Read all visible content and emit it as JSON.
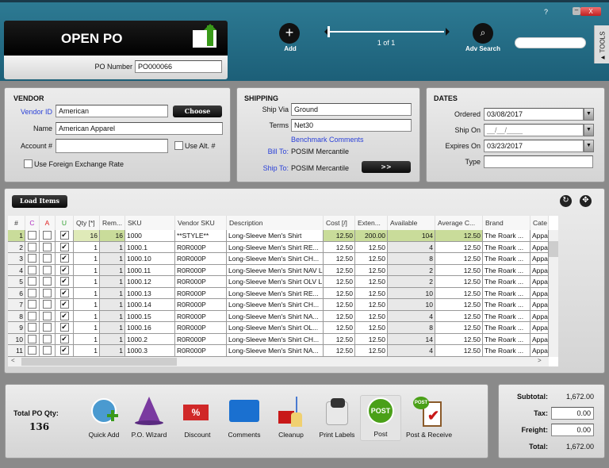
{
  "window": {
    "help": "?",
    "minimize": "–",
    "close": "X"
  },
  "header": {
    "title": "OPEN PO",
    "po_number_label": "PO Number",
    "po_number": "PO000066",
    "add_label": "Add",
    "pager": "1 of 1",
    "adv_search_label": "Adv Search",
    "search_placeholder": "",
    "tools_label": "TOOLS"
  },
  "vendor": {
    "heading": "VENDOR",
    "vendor_id_label": "Vendor ID",
    "vendor_id": "American",
    "choose": "Choose",
    "name_label": "Name",
    "name": "American Apparel",
    "account_label": "Account #",
    "account": "",
    "use_alt_label": "Use Alt. #",
    "use_alt": false,
    "foreign_label": "Use Foreign Exchange Rate",
    "foreign": false
  },
  "shipping": {
    "heading": "SHIPPING",
    "ship_via_label": "Ship Via",
    "ship_via": "Ground",
    "terms_label": "Terms",
    "terms": "Net30",
    "benchmark": "Benchmark Comments",
    "bill_to_label": "Bill To:",
    "bill_to": "POSIM Mercantile",
    "ship_to_label": "Ship To:",
    "ship_to": "POSIM Mercantile",
    "more": ">>"
  },
  "dates": {
    "heading": "DATES",
    "ordered_label": "Ordered",
    "ordered": "03/08/2017",
    "ship_on_label": "Ship On",
    "ship_on": "__/__/____",
    "expires_label": "Expires On",
    "expires": "03/23/2017",
    "type_label": "Type",
    "type": ""
  },
  "items": {
    "load_items": "Load Items",
    "columns": [
      "#",
      "C",
      "A",
      "U",
      "Qty [*]",
      "Rem...",
      "SKU",
      "Vendor SKU",
      "Description",
      "Cost [/]",
      "Exten...",
      "Available",
      "Average C...",
      "Brand",
      "Cate"
    ],
    "rows": [
      [
        "1",
        false,
        false,
        true,
        "16",
        "16",
        "1000",
        "**STYLE**",
        "Long-Sleeve Men's Shirt",
        "12.50",
        "200.00",
        "104",
        "12.50",
        "The Roark ...",
        "Appa"
      ],
      [
        "2",
        false,
        false,
        true,
        "1",
        "1",
        "1000.1",
        "R0R000P",
        "Long-Sleeve Men's Shirt RE...",
        "12.50",
        "12.50",
        "4",
        "12.50",
        "The Roark ...",
        "Appa"
      ],
      [
        "3",
        false,
        false,
        true,
        "1",
        "1",
        "1000.10",
        "R0R000P",
        "Long-Sleeve Men's Shirt CH...",
        "12.50",
        "12.50",
        "8",
        "12.50",
        "The Roark ...",
        "Appa"
      ],
      [
        "4",
        false,
        false,
        true,
        "1",
        "1",
        "1000.11",
        "R0R000P",
        "Long-Sleeve Men's Shirt NAV L",
        "12.50",
        "12.50",
        "2",
        "12.50",
        "The Roark ...",
        "Appa"
      ],
      [
        "5",
        false,
        false,
        true,
        "1",
        "1",
        "1000.12",
        "R0R000P",
        "Long-Sleeve Men's Shirt OLV L",
        "12.50",
        "12.50",
        "2",
        "12.50",
        "The Roark ...",
        "Appa"
      ],
      [
        "6",
        false,
        false,
        true,
        "1",
        "1",
        "1000.13",
        "R0R000P",
        "Long-Sleeve Men's Shirt RE...",
        "12.50",
        "12.50",
        "10",
        "12.50",
        "The Roark ...",
        "Appa"
      ],
      [
        "7",
        false,
        false,
        true,
        "1",
        "1",
        "1000.14",
        "R0R000P",
        "Long-Sleeve Men's Shirt CH...",
        "12.50",
        "12.50",
        "10",
        "12.50",
        "The Roark ...",
        "Appa"
      ],
      [
        "8",
        false,
        false,
        true,
        "1",
        "1",
        "1000.15",
        "R0R000P",
        "Long-Sleeve Men's Shirt NA...",
        "12.50",
        "12.50",
        "4",
        "12.50",
        "The Roark ...",
        "Appa"
      ],
      [
        "9",
        false,
        false,
        true,
        "1",
        "1",
        "1000.16",
        "R0R000P",
        "Long-Sleeve Men's Shirt OL...",
        "12.50",
        "12.50",
        "8",
        "12.50",
        "The Roark ...",
        "Appa"
      ],
      [
        "10",
        false,
        false,
        true,
        "1",
        "1",
        "1000.2",
        "R0R000P",
        "Long-Sleeve Men's Shirt CH...",
        "12.50",
        "12.50",
        "14",
        "12.50",
        "The Roark ...",
        "Appa"
      ],
      [
        "11",
        false,
        false,
        true,
        "1",
        "1",
        "1000.3",
        "R0R000P",
        "Long-Sleeve Men's Shirt NA...",
        "12.50",
        "12.50",
        "4",
        "12.50",
        "The Roark ...",
        "Appa"
      ]
    ]
  },
  "footer": {
    "total_qty_label": "Total PO Qty:",
    "total_qty": "136",
    "tools": [
      {
        "label": "Quick Add",
        "icon": "quick-add-icon"
      },
      {
        "label": "P.O. Wizard",
        "icon": "wizard-hat-icon"
      },
      {
        "label": "Discount",
        "icon": "discount-tag-icon"
      },
      {
        "label": "Comments",
        "icon": "speech-bubble-icon"
      },
      {
        "label": "Cleanup",
        "icon": "broom-icon"
      },
      {
        "label": "Print Labels",
        "icon": "label-printer-icon"
      },
      {
        "label": "Post",
        "icon": "post-icon",
        "badge": "POST"
      },
      {
        "label": "Post & Receive",
        "icon": "post-receive-icon",
        "badge": "POST"
      }
    ]
  },
  "totals": {
    "subtotal_label": "Subtotal:",
    "subtotal": "1,672.00",
    "tax_label": "Tax:",
    "tax": "0.00",
    "freight_label": "Freight:",
    "freight": "0.00",
    "total_label": "Total:",
    "total": "1,672.00"
  },
  "colors": {
    "header": "#1f6a84",
    "selected_row": "#c9dc9a",
    "link": "#2a40d8",
    "post": "#4aa018"
  }
}
